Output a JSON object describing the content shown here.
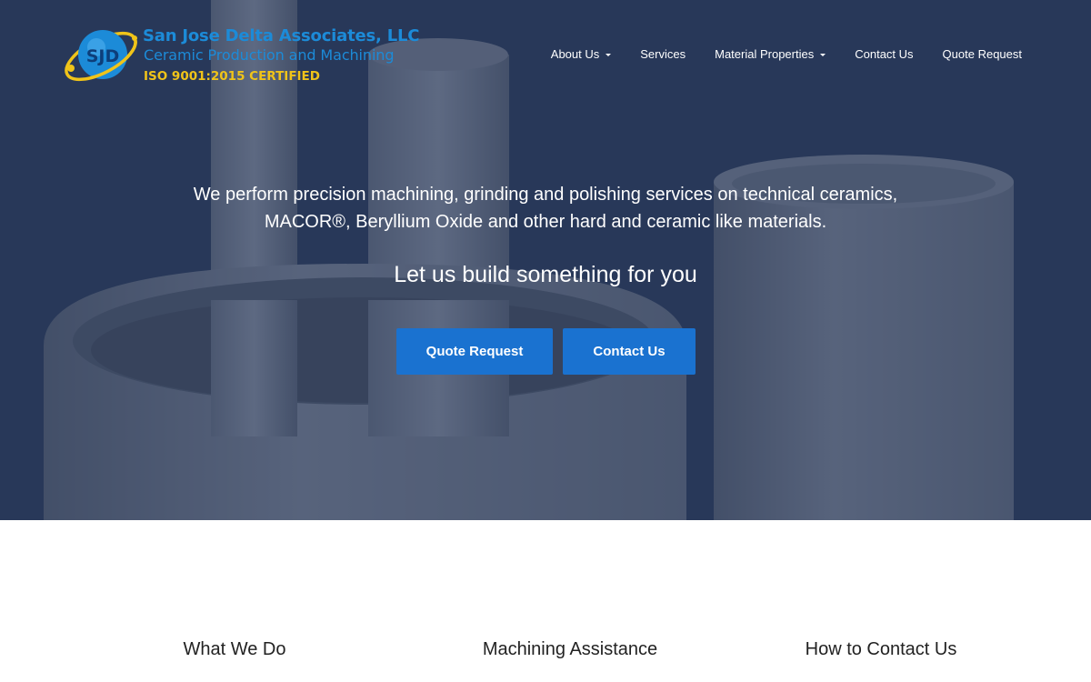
{
  "logo": {
    "monogram": "SJD",
    "name": "San Jose Delta Associates, LLC",
    "tagline": "Ceramic Production and Machining",
    "certification": "ISO 9001:2015 CERTIFIED"
  },
  "nav": {
    "items": [
      {
        "label": "About Us",
        "dropdown": true
      },
      {
        "label": "Services",
        "dropdown": false
      },
      {
        "label": "Material Properties",
        "dropdown": true
      },
      {
        "label": "Contact Us",
        "dropdown": false
      },
      {
        "label": "Quote Request",
        "dropdown": false
      }
    ]
  },
  "hero": {
    "description": "We perform precision machining, grinding and polishing services on technical ceramics, MACOR®, Beryllium Oxide and other hard and ceramic like materials.",
    "subheading": "Let us build something for you",
    "buttons": {
      "quote": "Quote Request",
      "contact": "Contact Us"
    }
  },
  "features": {
    "col1": "What We Do",
    "col2": "Machining Assistance",
    "col3": "How to Contact Us"
  },
  "colors": {
    "hero_overlay": "#162a54",
    "logo_blue": "#1c8bd8",
    "logo_gold": "#f0c419",
    "button": "#1a72d0"
  }
}
